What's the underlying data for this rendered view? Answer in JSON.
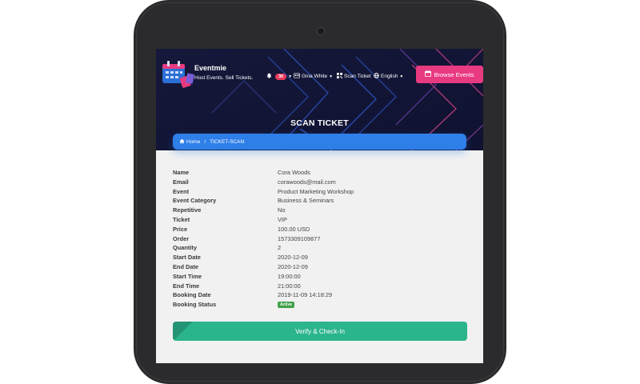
{
  "brand": {
    "name": "Eventmie",
    "tagline": "Host Events. Sell Tickets."
  },
  "nav": {
    "notifications_count": "30",
    "user_name": "Gina White",
    "scan_ticket": "Scan Ticket",
    "language": "English",
    "browse_events": "Browse Events"
  },
  "page": {
    "title": "SCAN TICKET"
  },
  "breadcrumb": {
    "home": "Home",
    "current": "TICKET-SCAN"
  },
  "details": {
    "rows": [
      {
        "label": "Name",
        "value": "Cora Woods"
      },
      {
        "label": "Email",
        "value": "corawoods@mail.com"
      },
      {
        "label": "Event",
        "value": "Product Marketing Workshop"
      },
      {
        "label": "Event Category",
        "value": "Business & Seminars"
      },
      {
        "label": "Repetitive",
        "value": "No"
      },
      {
        "label": "Ticket",
        "value": "VIP"
      },
      {
        "label": "Price",
        "value": "100.00 USD"
      },
      {
        "label": "Order",
        "value": "1573309109877"
      },
      {
        "label": "Quantity",
        "value": "2"
      },
      {
        "label": "Start Date",
        "value": "2020-12-09"
      },
      {
        "label": "End Date",
        "value": "2020-12-09"
      },
      {
        "label": "Start Time",
        "value": "19:00:00"
      },
      {
        "label": "End Time",
        "value": "21:00:00"
      },
      {
        "label": "Booking Date",
        "value": "2019-11-09 14:18:29"
      }
    ],
    "status_label": "Booking Status",
    "status_value": "Active"
  },
  "actions": {
    "verify": "Verify & Check-In"
  },
  "colors": {
    "hero_bg": "#1b1e3a",
    "accent_pink": "#e83a80",
    "breadcrumb_blue": "#2f7fe8",
    "verify_green": "#2bb58d",
    "active_green": "#3fa14a",
    "badge_red": "#e63a5c"
  }
}
